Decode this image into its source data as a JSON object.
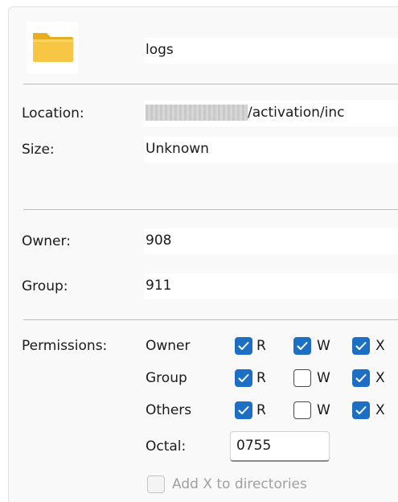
{
  "name": {
    "value": "logs"
  },
  "location": {
    "label": "Location:",
    "value": "/activation/inc"
  },
  "size": {
    "label": "Size:",
    "value": "Unknown"
  },
  "owner": {
    "label": "Owner:",
    "value": "908"
  },
  "group": {
    "label": "Group:",
    "value": "911"
  },
  "permissions": {
    "label": "Permissions:",
    "rows": [
      {
        "label": "Owner",
        "r": true,
        "w": true,
        "x": true
      },
      {
        "label": "Group",
        "r": true,
        "w": false,
        "x": true
      },
      {
        "label": "Others",
        "r": true,
        "w": false,
        "x": true
      }
    ],
    "letters": {
      "r": "R",
      "w": "W",
      "x": "X"
    },
    "octal_label": "Octal:",
    "octal_value": "0755",
    "add_x_label": "Add X to directories",
    "add_x_checked": false,
    "add_x_enabled": false
  },
  "colors": {
    "accent": "#1d6fc4",
    "folder": "#f5c342"
  },
  "icons": {
    "folder": "folder-icon",
    "check": "checkmark-icon"
  }
}
